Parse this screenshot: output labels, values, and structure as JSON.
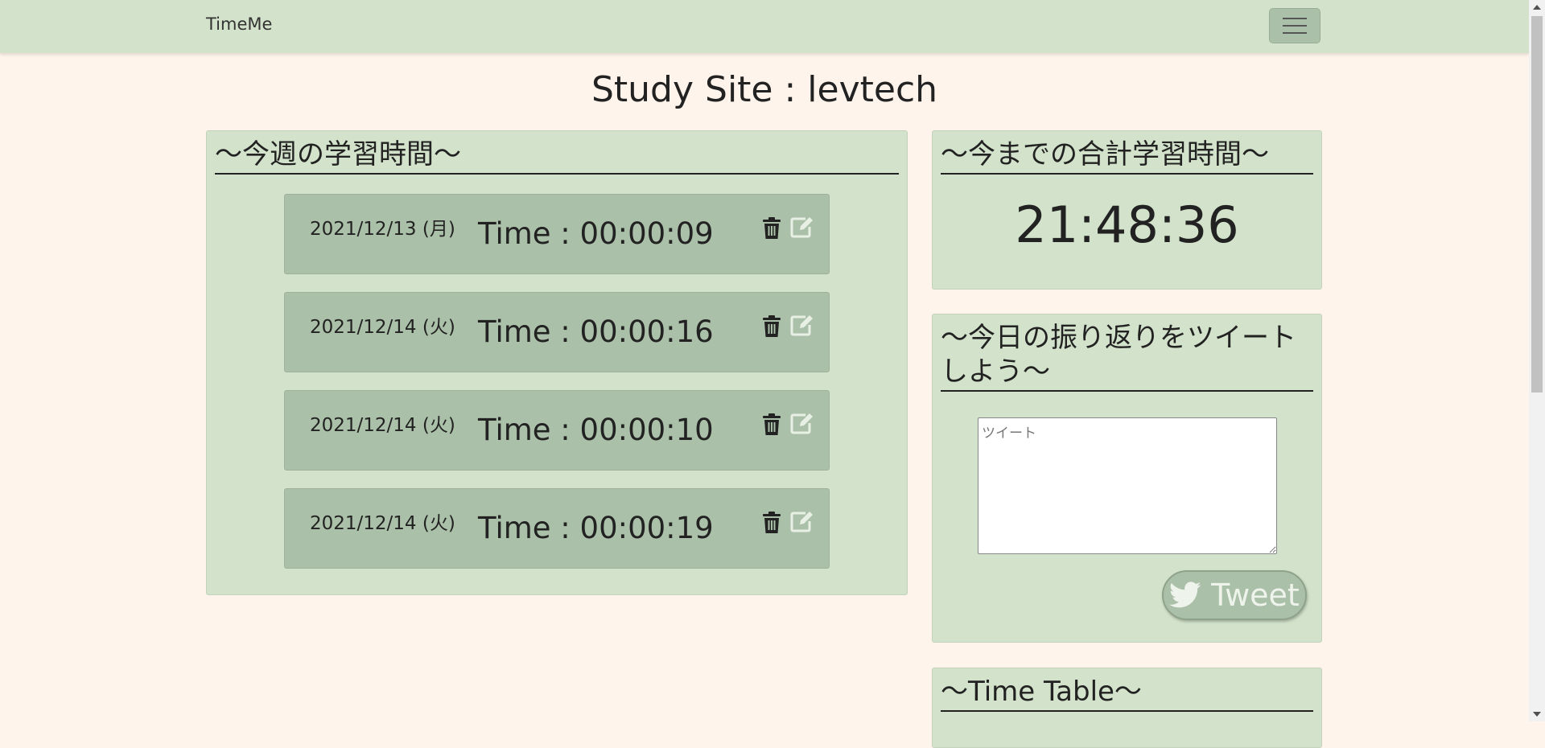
{
  "navbar": {
    "brand": "TimeMe"
  },
  "page_title": "Study Site : levtech",
  "weekly": {
    "heading": "～今週の学習時間～",
    "records": [
      {
        "date": "2021/12/13 (月)",
        "time": "Time : 00:00:09"
      },
      {
        "date": "2021/12/14 (火)",
        "time": "Time : 00:00:16"
      },
      {
        "date": "2021/12/14 (火)",
        "time": "Time : 00:00:10"
      },
      {
        "date": "2021/12/14 (火)",
        "time": "Time : 00:00:19"
      }
    ]
  },
  "total": {
    "heading": "～今までの合計学習時間～",
    "value": "21:48:36"
  },
  "tweet": {
    "heading": "～今日の振り返りをツイートしよう～",
    "placeholder": "ツイート",
    "button_label": "Tweet"
  },
  "timetable": {
    "heading": "～Time Table～"
  },
  "colors": {
    "background": "#fff4ec",
    "panel": "#d3e3cb",
    "record": "#abc0a8",
    "edit_icon": "#e8efe5"
  },
  "icons": {
    "menu": "hamburger-menu-icon",
    "delete": "trash-icon",
    "edit": "edit-icon",
    "tweet": "twitter-bird-icon"
  }
}
